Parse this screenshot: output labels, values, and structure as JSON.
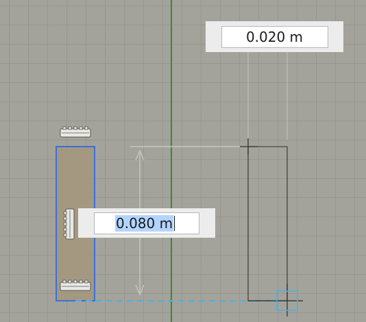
{
  "dimensions": {
    "width_label": "0.020 m",
    "height_label": "0.080 m"
  },
  "colors": {
    "background": "#a3a39b",
    "grid": "#8c8c84",
    "y_axis": "#2f8f2f",
    "selection": "#3b6fd6",
    "selected_fill": "#a6977d",
    "snap_guide": "#4fb0e0",
    "outline": "#3a3a3a"
  },
  "icons": {
    "top_handle": "resize-handle-icon",
    "side_handle": "resize-handle-icon",
    "bottom_handle": "resize-handle-icon",
    "corner_snap": "snap-point-icon"
  }
}
